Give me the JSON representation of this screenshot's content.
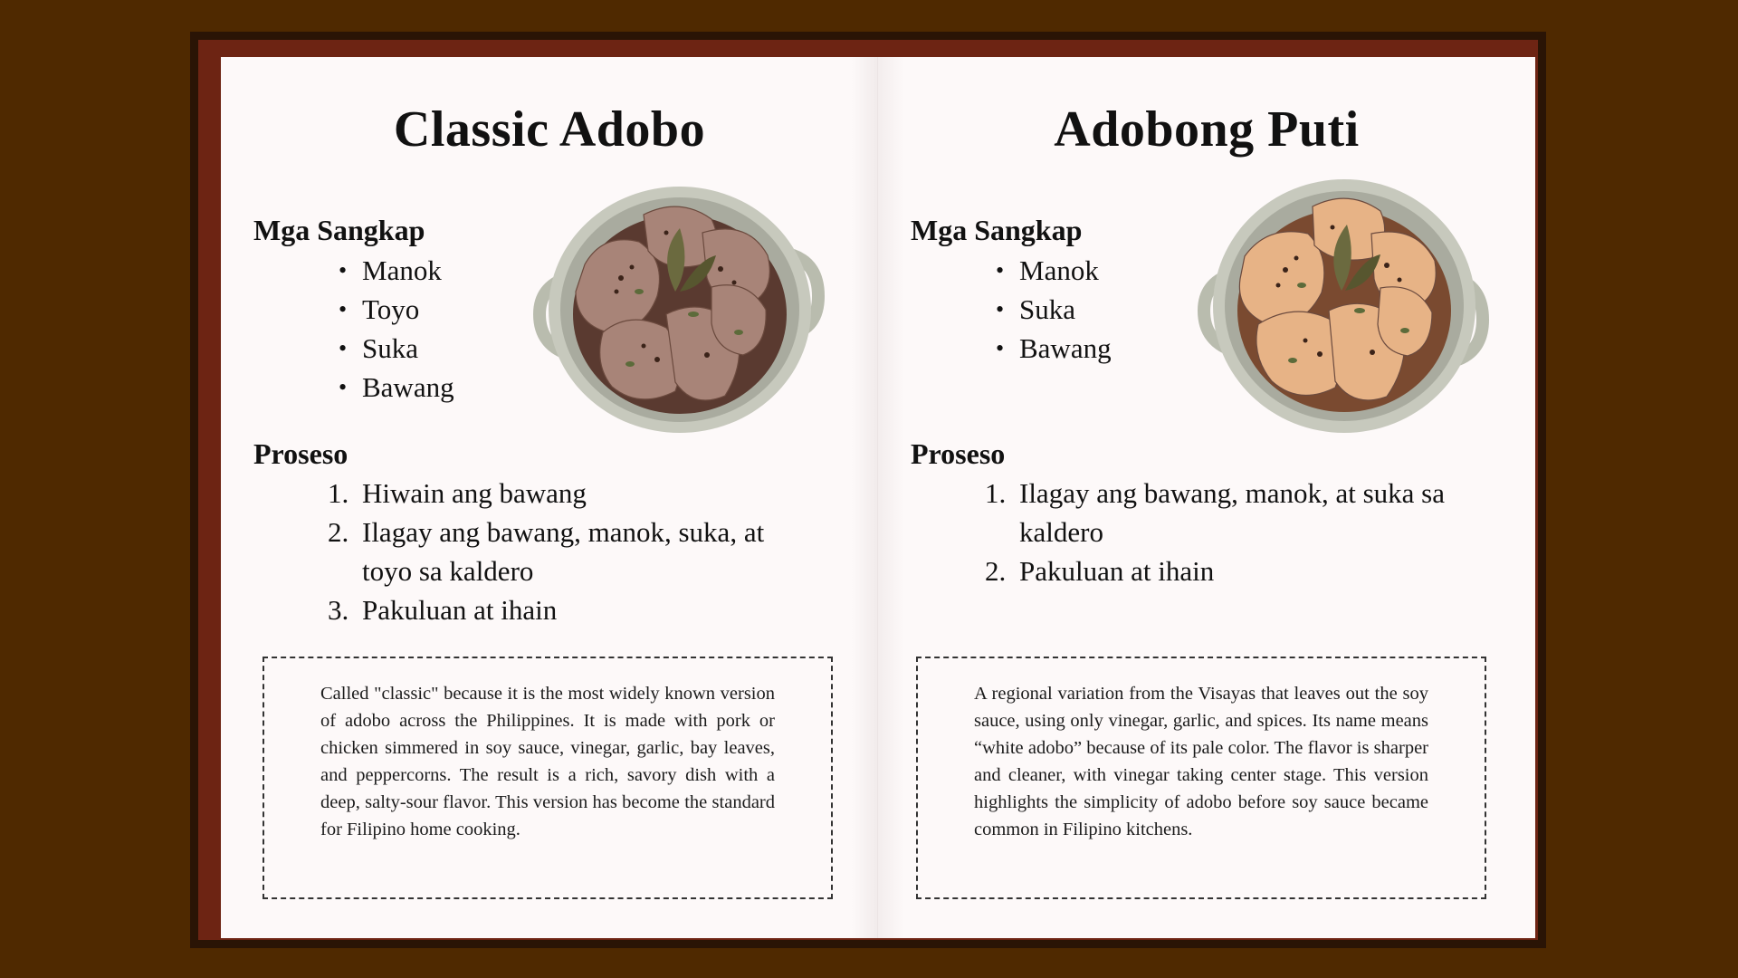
{
  "pages": [
    {
      "title": "Classic Adobo",
      "ingredients_heading": "Mga Sangkap",
      "ingredients": [
        "Manok",
        "Toyo",
        "Suka",
        "Bawang"
      ],
      "process_heading": "Proseso",
      "steps": [
        {
          "num": "1.",
          "text": "Hiwain ang bawang"
        },
        {
          "num": "2.",
          "text": "Ilagay ang bawang, manok, suka, at toyo sa kaldero"
        },
        {
          "num": "3.",
          "text": "Pakuluan at ihain"
        }
      ],
      "note": "Called \"classic\" because it is the most widely known version of adobo across the Philippines. It is made with pork or chicken simmered in soy sauce, vinegar, garlic, bay leaves, and peppercorns. The result is a rich, savory dish with a deep, salty-sour flavor. This version has become the standard for Filipino home cooking.",
      "dish_color": "#a88478"
    },
    {
      "title": "Adobong Puti",
      "ingredients_heading": "Mga Sangkap",
      "ingredients": [
        "Manok",
        "Suka",
        "Bawang"
      ],
      "process_heading": "Proseso",
      "steps": [
        {
          "num": "1.",
          "text": "Ilagay ang bawang, manok, at suka sa kaldero"
        },
        {
          "num": "2.",
          "text": "Pakuluan at ihain"
        }
      ],
      "note": "A regional variation from the Visayas that leaves out the soy sauce, using only vinegar, garlic, and spices. Its name means “white adobo” because of its pale color. The flavor is sharper and cleaner, with vinegar taking center stage. This version highlights the simplicity of adobo before soy sauce became common in Filipino kitchens.",
      "dish_color": "#e7b386"
    }
  ],
  "colors": {
    "background": "#4f2900",
    "cover": "#6d2413",
    "paper": "#fdf9f9"
  }
}
